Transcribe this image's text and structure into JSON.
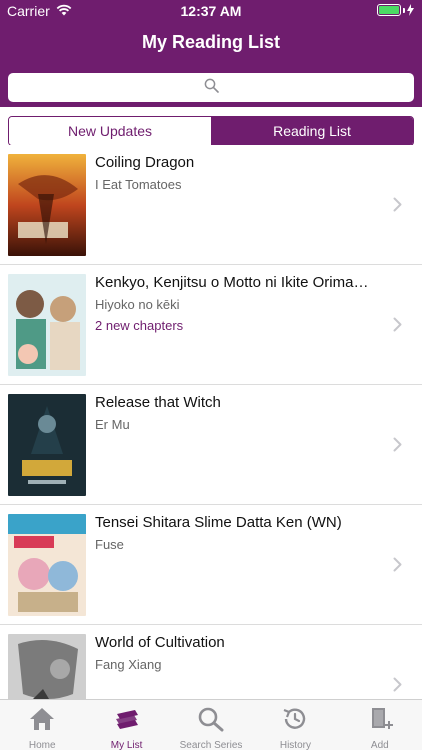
{
  "status": {
    "carrier": "Carrier",
    "time": "12:37 AM",
    "battery_level": 1.0,
    "battery_color": "#4cd964"
  },
  "nav": {
    "title": "My Reading List"
  },
  "search": {
    "placeholder": ""
  },
  "segments": [
    {
      "label": "New Updates",
      "active": false
    },
    {
      "label": "Reading List",
      "active": true
    }
  ],
  "items": [
    {
      "title": "Coiling Dragon",
      "author": "I Eat Tomatoes",
      "updates": ""
    },
    {
      "title": "Kenkyo, Kenjitsu o Motto ni Ikite Orima…",
      "author": "Hiyoko no kēki",
      "updates": "2 new chapters"
    },
    {
      "title": "Release that Witch",
      "author": "Er Mu",
      "updates": ""
    },
    {
      "title": "Tensei Shitara Slime Datta Ken (WN)",
      "author": "Fuse",
      "updates": ""
    },
    {
      "title": "World of Cultivation",
      "author": "Fang Xiang",
      "updates": ""
    }
  ],
  "tabs": [
    {
      "label": "Home",
      "icon": "home-icon",
      "selected": false
    },
    {
      "label": "My List",
      "icon": "books-icon",
      "selected": true
    },
    {
      "label": "Search Series",
      "icon": "search-icon",
      "selected": false
    },
    {
      "label": "History",
      "icon": "history-icon",
      "selected": false
    },
    {
      "label": "Add",
      "icon": "add-book-icon",
      "selected": false
    }
  ],
  "colors": {
    "brand": "#6f1d6e",
    "tab_inactive": "#8e8e93"
  }
}
